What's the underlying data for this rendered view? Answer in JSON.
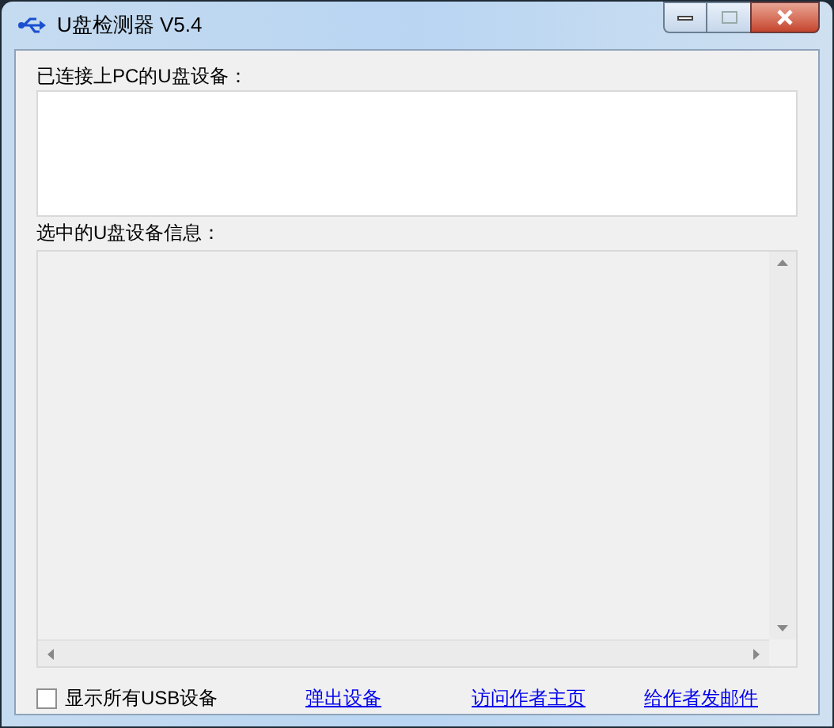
{
  "window": {
    "title": "U盘检测器 V5.4"
  },
  "devices_label": "已连接上PC的U盘设备：",
  "info_label": "选中的U盘设备信息：",
  "show_all": {
    "label": "显示所有USB设备",
    "checked": false
  },
  "links": [
    "弹出设备",
    "访问作者主页",
    "给作者发邮件"
  ]
}
